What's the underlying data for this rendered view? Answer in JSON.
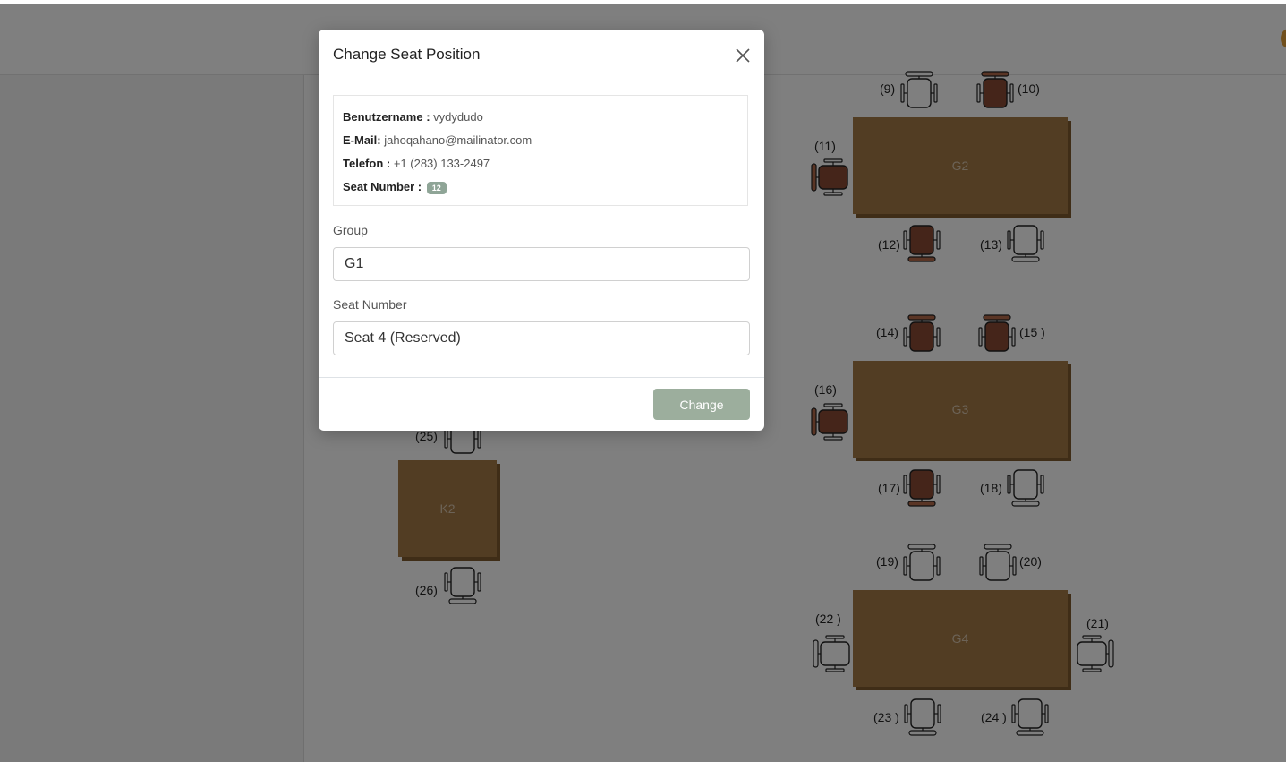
{
  "modal": {
    "title": "Change Seat Position",
    "info": {
      "username_label": "Benutzername :",
      "username": "vydydudo",
      "email_label": "E-Mail:",
      "email": "jahoqahano@mailinator.com",
      "phone_label": "Telefon :",
      "phone": "+1 (283) 133-2497",
      "seat_label": "Seat Number :",
      "seat_badge": "12"
    },
    "group_label": "Group",
    "group_value": "G1",
    "seat_number_label": "Seat Number",
    "seat_number_value": "Seat 4 (Reserved)",
    "change_button": "Change"
  },
  "floor": {
    "tables": [
      {
        "name": "G2"
      },
      {
        "name": "G3"
      },
      {
        "name": "G4"
      },
      {
        "name": "K2"
      }
    ],
    "seats": [
      {
        "label": "(9)",
        "status": "free"
      },
      {
        "label": "(10)",
        "status": "taken"
      },
      {
        "label": "(11)",
        "status": "taken"
      },
      {
        "label": "(12)",
        "status": "taken"
      },
      {
        "label": "(13)",
        "status": "free"
      },
      {
        "label": "(14)",
        "status": "taken"
      },
      {
        "label": "(15 )",
        "status": "taken"
      },
      {
        "label": "(16)",
        "status": "taken"
      },
      {
        "label": "(17)",
        "status": "taken"
      },
      {
        "label": "(18)",
        "status": "free"
      },
      {
        "label": "(19)",
        "status": "free"
      },
      {
        "label": "(20)",
        "status": "free"
      },
      {
        "label": "(21)",
        "status": "free"
      },
      {
        "label": "(22 )",
        "status": "free"
      },
      {
        "label": "(23 )",
        "status": "free"
      },
      {
        "label": "(24 )",
        "status": "free"
      },
      {
        "label": "(25)",
        "status": "free"
      },
      {
        "label": "(26)",
        "status": "free"
      }
    ]
  },
  "colors": {
    "table": "#a57a47",
    "seat_taken": "#8a4a34",
    "seat_free": "#ffffff",
    "button": "#9cae9d"
  }
}
